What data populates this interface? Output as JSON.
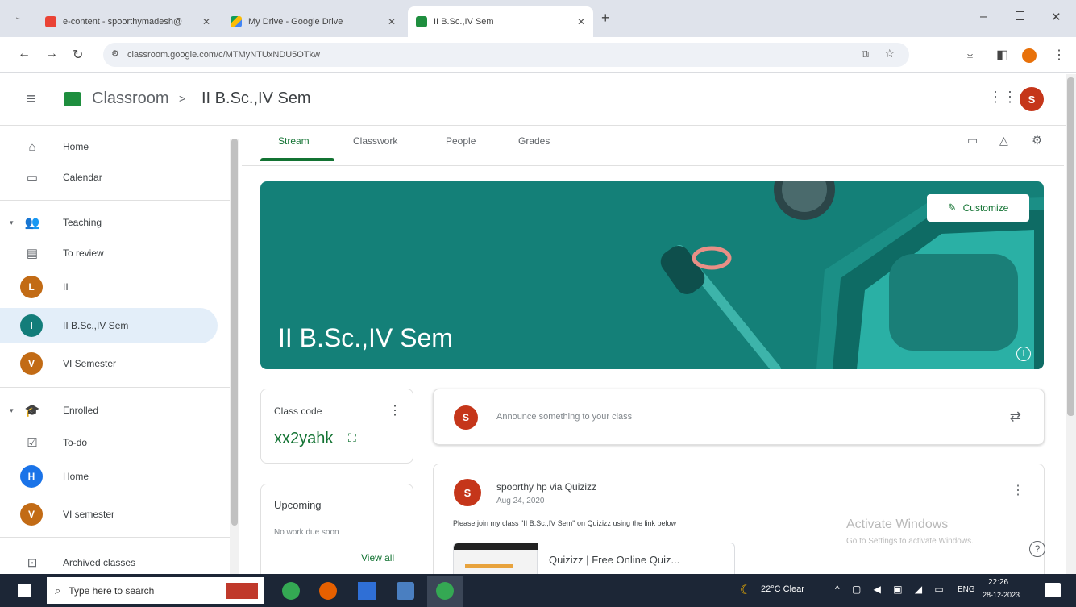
{
  "browser": {
    "tabs": [
      {
        "title": "e-content - spoorthymadesh@",
        "icon": "gmail-icon"
      },
      {
        "title": "My Drive - Google Drive",
        "icon": "drive-icon"
      },
      {
        "title": "II B.Sc.,IV Sem",
        "icon": "classroom-icon",
        "active": true
      }
    ],
    "new_tab": "+",
    "url": "classroom.google.com/c/MTMyNTUxNDU5OTkw",
    "window_controls": [
      "minimize",
      "maximize",
      "close"
    ]
  },
  "header": {
    "app_name": "Classroom",
    "separator": ">",
    "class_name": "II B.Sc.,IV Sem",
    "user_initial": "S"
  },
  "sidebar": {
    "items": [
      {
        "label": "Home",
        "icon": "home-icon"
      },
      {
        "label": "Calendar",
        "icon": "calendar-icon"
      },
      {
        "label": "Teaching",
        "icon": "people-icon"
      },
      {
        "label": "To review",
        "icon": "review-folder-icon"
      },
      {
        "label": "II",
        "avatar": "L",
        "color": "#c26b15"
      },
      {
        "label": "II B.Sc.,IV Sem",
        "avatar": "I",
        "color": "#137d7a",
        "selected": true
      },
      {
        "label": "VI Semester",
        "avatar": "V",
        "color": "#c26b15"
      },
      {
        "label": "Enrolled",
        "icon": "graduation-cap-icon"
      },
      {
        "label": "To-do",
        "icon": "todo-icon"
      },
      {
        "label": "Home",
        "avatar": "H",
        "color": "#1a73e8"
      },
      {
        "label": "VI semester",
        "avatar": "V",
        "color": "#c26b15"
      },
      {
        "label": "Archived classes",
        "icon": "archive-icon"
      }
    ]
  },
  "main": {
    "tabs": [
      {
        "label": "Stream",
        "active": true
      },
      {
        "label": "Classwork"
      },
      {
        "label": "People"
      },
      {
        "label": "Grades"
      }
    ],
    "banner": {
      "title": "II B.Sc.,IV Sem",
      "customize_label": "Customize",
      "color": "#148078"
    },
    "class_code": {
      "label": "Class code",
      "code": "xx2yahk"
    },
    "upcoming": {
      "label": "Upcoming",
      "empty_text": "No work due soon",
      "view_all": "View all"
    },
    "announce": {
      "placeholder": "Announce something to your class",
      "avatar": "S"
    },
    "post": {
      "author": "spoorthy hp via Quizizz",
      "date": "Aug 24, 2020",
      "body": "Please join my class \"II B.Sc.,IV Sem\" on Quizizz using the link below",
      "attachment_title": "Quizizz | Free Online Quiz...",
      "avatar": "S"
    }
  },
  "watermark": {
    "line1": "Activate Windows",
    "line2": "Go to Settings to activate Windows."
  },
  "taskbar": {
    "search_placeholder": "Type here to search",
    "weather": "22°C Clear",
    "language": "ENG",
    "time": "22:26",
    "date": "28-12-2023"
  },
  "colors": {
    "accent_green": "#137333",
    "banner_teal": "#148078",
    "avatar_red": "#c5361a"
  }
}
